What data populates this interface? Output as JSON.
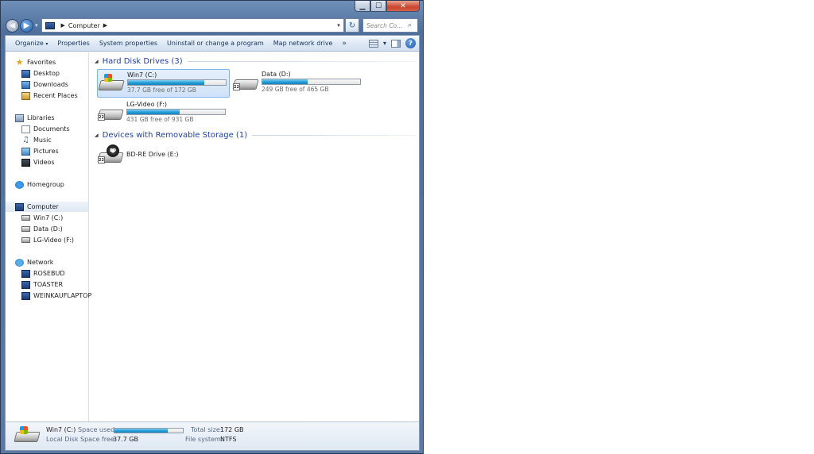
{
  "window": {
    "caption_min": "▁",
    "caption_max": "☐",
    "caption_close": "✕"
  },
  "nav": {
    "back": "◀",
    "forward": "▶",
    "recent": "▾",
    "breadcrumb": "Computer",
    "crumb_sep": "▶",
    "addr_dropdown": "▾",
    "refresh": "↻",
    "search_placeholder": "Search Co...",
    "search_icon": "⌕"
  },
  "toolbar": {
    "organize": "Organize",
    "organize_arrow": "▾",
    "properties": "Properties",
    "system_properties": "System properties",
    "uninstall": "Uninstall or change a program",
    "map_drive": "Map network drive",
    "more": "»",
    "views_arrow": "▾",
    "help": "?"
  },
  "sidebar": {
    "favorites": "Favorites",
    "desktop": "Desktop",
    "downloads": "Downloads",
    "recent_places": "Recent Places",
    "libraries": "Libraries",
    "documents": "Documents",
    "music": "Music",
    "pictures": "Pictures",
    "videos": "Videos",
    "homegroup": "Homegroup",
    "computer": "Computer",
    "win7": "Win7 (C:)",
    "data": "Data (D:)",
    "lgvideo": "LG-Video (F:)",
    "network": "Network",
    "rosebud": "ROSEBUD",
    "toaster": "TOASTER",
    "weinkauf": "WEINKAUFLAPTOP",
    "star": "★",
    "note": "♫"
  },
  "main": {
    "hdd_group": "Hard Disk Drives (3)",
    "removable_group": "Devices with Removable Storage (1)",
    "group_toggle": "◢",
    "drives": [
      {
        "name": "Win7 (C:)",
        "free": "37.7 GB free of 172 GB",
        "used_fraction": 0.78
      },
      {
        "name": "Data (D:)",
        "free": "249 GB free of 465 GB",
        "used_fraction": 0.46
      },
      {
        "name": "LG-Video (F:)",
        "free": "431 GB free of 931 GB",
        "used_fraction": 0.54
      }
    ],
    "removable": {
      "name": "BD-RE Drive (E:)",
      "disc_label": "BD"
    },
    "badge": "22"
  },
  "details": {
    "name": "Win7 (C:)",
    "type": "Local Disk",
    "space_used_label": "Space used:",
    "space_used_fraction": 0.78,
    "space_free_label": "Space free:",
    "space_free_value": "37.7 GB",
    "total_size_label": "Total size:",
    "total_size_value": "172 GB",
    "file_system_label": "File system:",
    "file_system_value": "NTFS"
  }
}
